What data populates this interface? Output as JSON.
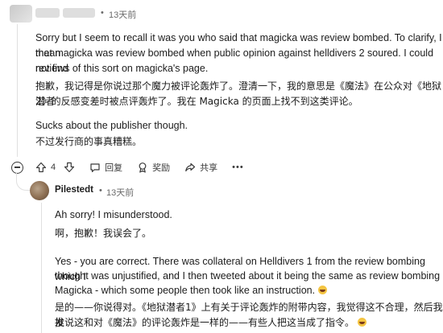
{
  "comment": {
    "time": "13天前",
    "dot": "•",
    "paragraphs_en": [
      "Sorry but I seem to recall it was you who said that magicka was review bombed. To clarify, I mean",
      "that magicka was review bombed when public opinion against helldivers 2 soured. I could not find",
      "reviews of this sort on magicka's page."
    ],
    "paragraphs_zh": [
      "抱歉，我记得是你说过那个魔力被评论轰炸了。澄清一下，我的意思是《魔法》在公众对《地狱潜者",
      "2》的反感变差时被点评轰炸了。我在 Magicka 的页面上找不到这类评论。"
    ],
    "line2_en": "Sucks about the publisher though.",
    "line2_zh": "不过发行商的事真糟糕。",
    "actions": {
      "upvote_count": "4",
      "reply_label": "回复",
      "award_label": "奖励",
      "share_label": "共享",
      "more_label": "•••"
    }
  },
  "reply": {
    "username": "Pilestedt",
    "dot": "•",
    "time": "13天前",
    "l1_en": "Ah sorry! I misunderstood.",
    "l1_zh": "啊，抱歉！我误会了。",
    "l2_en": [
      "Yes - you are correct. There was collateral on Helldivers 1 from the review bombing which I",
      "thought was unjustified, and I then tweeted about it being the same as review bombing",
      "Magicka - which some people then took like an instruction."
    ],
    "l2_zh": [
      "是的——你说得对。《地狱潜者1》上有关于评论轰炸的附带内容，我觉得这不合理，然后我发",
      "推说这和对《魔法》的评论轰炸是一样的——有些人把这当成了指令。"
    ]
  }
}
